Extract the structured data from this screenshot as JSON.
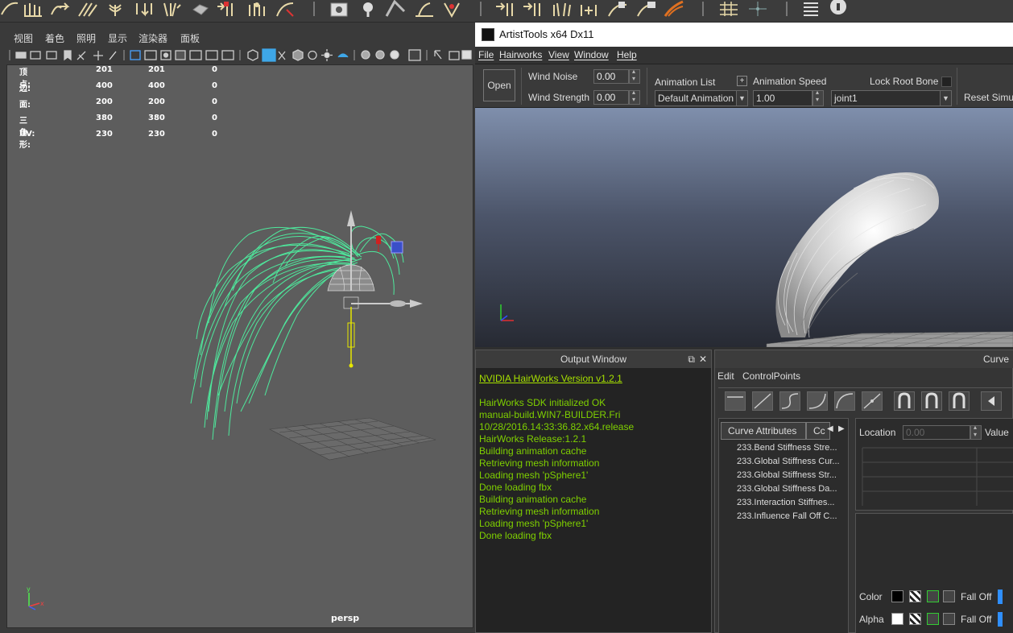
{
  "maya": {
    "menu": [
      "视图",
      "着色",
      "照明",
      "显示",
      "渲染器",
      "面板"
    ],
    "hud": [
      {
        "label": "顶点:",
        "v1": "201",
        "v2": "201",
        "v3": "0"
      },
      {
        "label": "边:",
        "v1": "400",
        "v2": "400",
        "v3": "0"
      },
      {
        "label": "面:",
        "v1": "200",
        "v2": "200",
        "v3": "0"
      },
      {
        "label": "三角形:",
        "v1": "380",
        "v2": "380",
        "v3": "0"
      },
      {
        "label": "UV:",
        "v1": "230",
        "v2": "230",
        "v3": "0"
      }
    ],
    "camera": "persp",
    "axis_y": "y",
    "axis_x": "x"
  },
  "artisttools": {
    "title": "ArtistTools x64 Dx11",
    "menu": [
      "File",
      "Hairworks",
      "View",
      "Window",
      "Help"
    ],
    "open_label": "Open",
    "wind_noise_label": "Wind Noise",
    "wind_noise_value": "0.00",
    "wind_strength_label": "Wind Strength",
    "wind_strength_value": "0.00",
    "animation_list_label": "Animation List",
    "animation_list_value": "Default Animation",
    "add_label": "+",
    "animation_speed_label": "Animation Speed",
    "animation_speed_value": "1.00",
    "lock_root_bone_label": "Lock Root Bone",
    "bone_value": "joint1",
    "reset_label": "Reset Simul"
  },
  "output": {
    "title": "Output Window",
    "version_link": "NVIDIA HairWorks Version v1.2.1",
    "lines": [
      "",
      "HairWorks SDK initialized OK",
      "manual-build.WIN7-BUILDER.Fri",
      "10/28/2016.14:33:36.82.x64.release",
      "HairWorks Release:1.2.1",
      "Building animation cache",
      "Retrieving mesh information",
      "Loading mesh 'pSphere1'",
      "Done loading fbx",
      "Building animation cache",
      "Retrieving mesh information",
      "Loading mesh 'pSphere1'",
      "Done loading fbx"
    ]
  },
  "curve": {
    "title": "Curve",
    "menu_edit": "Edit",
    "menu_controlpoints": "ControlPoints",
    "tab_attributes": "Curve Attributes",
    "tab_second": "Cc",
    "attributes": [
      "233.Bend Stiffness Stre...",
      "233.Global Stiffness Cur...",
      "233.Global Stiffness Str...",
      "233.Global Stiffness Da...",
      "233.Interaction Stiffnes...",
      "233.Influence Fall Off C..."
    ],
    "location_label": "Location",
    "location_value": "0.00",
    "value_label": "Value",
    "color_label": "Color",
    "alpha_label": "Alpha",
    "falloff_label": "Fall Off"
  },
  "colors": {
    "hair_maya": "#4ef0a0",
    "output_text": "#7fd000",
    "accent_blue": "#2f8fff"
  }
}
